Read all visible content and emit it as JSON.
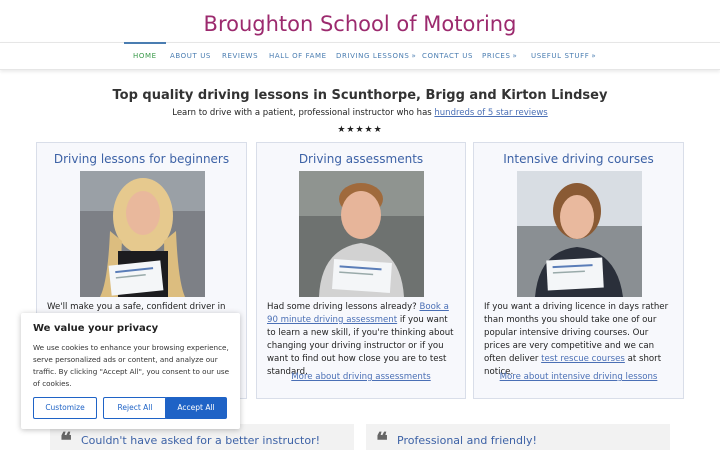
{
  "site": {
    "title": "Broughton School of Motoring"
  },
  "nav": {
    "items": [
      {
        "label": "HOME",
        "caret": ""
      },
      {
        "label": "ABOUT US",
        "caret": ""
      },
      {
        "label": "REVIEWS",
        "caret": ""
      },
      {
        "label": "HALL OF FAME",
        "caret": ""
      },
      {
        "label": "DRIVING LESSONS",
        "caret": "»"
      },
      {
        "label": "CONTACT US",
        "caret": ""
      },
      {
        "label": "PRICES",
        "caret": "»"
      },
      {
        "label": "USEFUL STUFF",
        "caret": "»"
      }
    ],
    "active": "HOME"
  },
  "hero": {
    "headline": "Top quality driving lessons in Scunthorpe, Brigg and Kirton Lindsey",
    "tagline_prefix": "Learn to drive with a patient, professional instructor who has ",
    "tagline_link": "hundreds of 5 star reviews",
    "stars": "★★★★★"
  },
  "cards": [
    {
      "title": "Driving lessons for beginners",
      "text_visible": "We'll make you a safe, confident driver in no",
      "more": ""
    },
    {
      "title": "Driving assessments",
      "text_prefix": "Had some driving lessons already? ",
      "text_link": "Book a 90 minute driving assessment",
      "text_suffix": " if you want to learn a new skill, if you're thinking about changing your driving instructor or if you want to find out how close you are to test standard.",
      "more": "More about driving assessments"
    },
    {
      "title": "Intensive driving courses",
      "text_prefix": "If you want a driving licence in days rather than months you should take one of our popular intensive driving courses. Our prices are very competitive and we can often deliver ",
      "text_link": "test rescue courses",
      "text_suffix": " at short notice.",
      "more": "More about intensive driving lessons"
    }
  ],
  "testimonials": [
    {
      "quote_mark": "❝",
      "text": "Couldn't have asked for a better instructor!"
    },
    {
      "quote_mark": "❝",
      "text": "Professional and friendly!"
    }
  ],
  "cookie_banner": {
    "title": "We value your privacy",
    "text": "We use cookies to enhance your browsing experience, serve personalized ads or content, and analyze our traffic. By clicking \"Accept All\", you consent to our use of cookies.",
    "customize_label": "Customize",
    "reject_label": "Reject All",
    "accept_label": "Accept All"
  },
  "colors": {
    "brand_title": "#9c2a6e",
    "link": "#4a6fb5",
    "nav_link": "#4a7db1",
    "nav_active": "#3a9a4a",
    "button_primary": "#1f63c6",
    "card_bg": "#f7f8fc"
  }
}
